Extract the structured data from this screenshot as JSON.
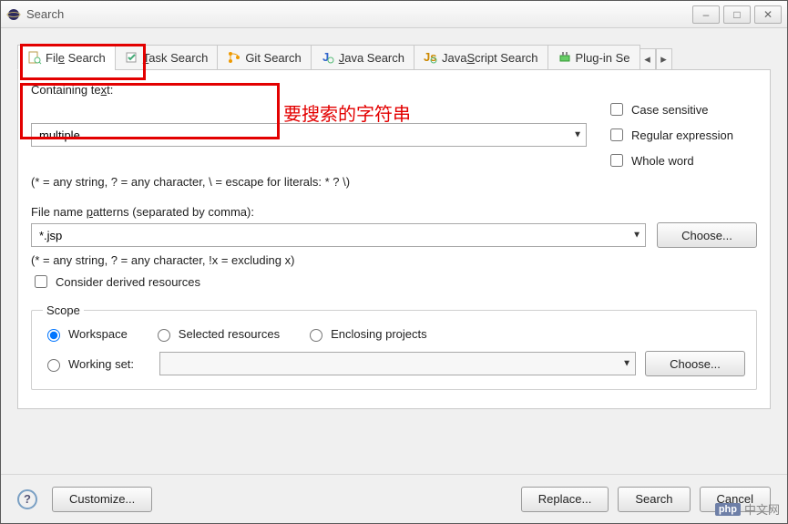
{
  "window": {
    "title": "Search"
  },
  "tabs": [
    {
      "label": "File Search",
      "mnemonic_index": 3
    },
    {
      "label": "Task Search",
      "mnemonic_index": 0
    },
    {
      "label": "Git Search"
    },
    {
      "label": "Java Search",
      "mnemonic_index": 0
    },
    {
      "label": "JavaScript Search",
      "mnemonic_index": 4
    },
    {
      "label": "Plug-in Se"
    }
  ],
  "annotation": "要搜索的字符串",
  "containing": {
    "label": "Containing text:",
    "value": "multiple",
    "hint": "(* = any string, ? = any character, \\ = escape for literals: * ? \\)"
  },
  "options": {
    "case_sensitive": "Case sensitive",
    "regex": "Regular expression",
    "whole_word": "Whole word"
  },
  "patterns": {
    "label": "File name patterns (separated by comma):",
    "value": "*.jsp",
    "choose": "Choose...",
    "hint": "(* = any string, ? = any character, !x = excluding x)"
  },
  "derived": "Consider derived resources",
  "scope": {
    "legend": "Scope",
    "workspace": "Workspace",
    "selected": "Selected resources",
    "enclosing": "Enclosing projects",
    "working_set": "Working set:",
    "choose": "Choose..."
  },
  "footer": {
    "customize": "Customize...",
    "replace": "Replace...",
    "search": "Search",
    "cancel": "Cancel"
  },
  "watermark": {
    "badge": "php",
    "text": "中文网"
  }
}
